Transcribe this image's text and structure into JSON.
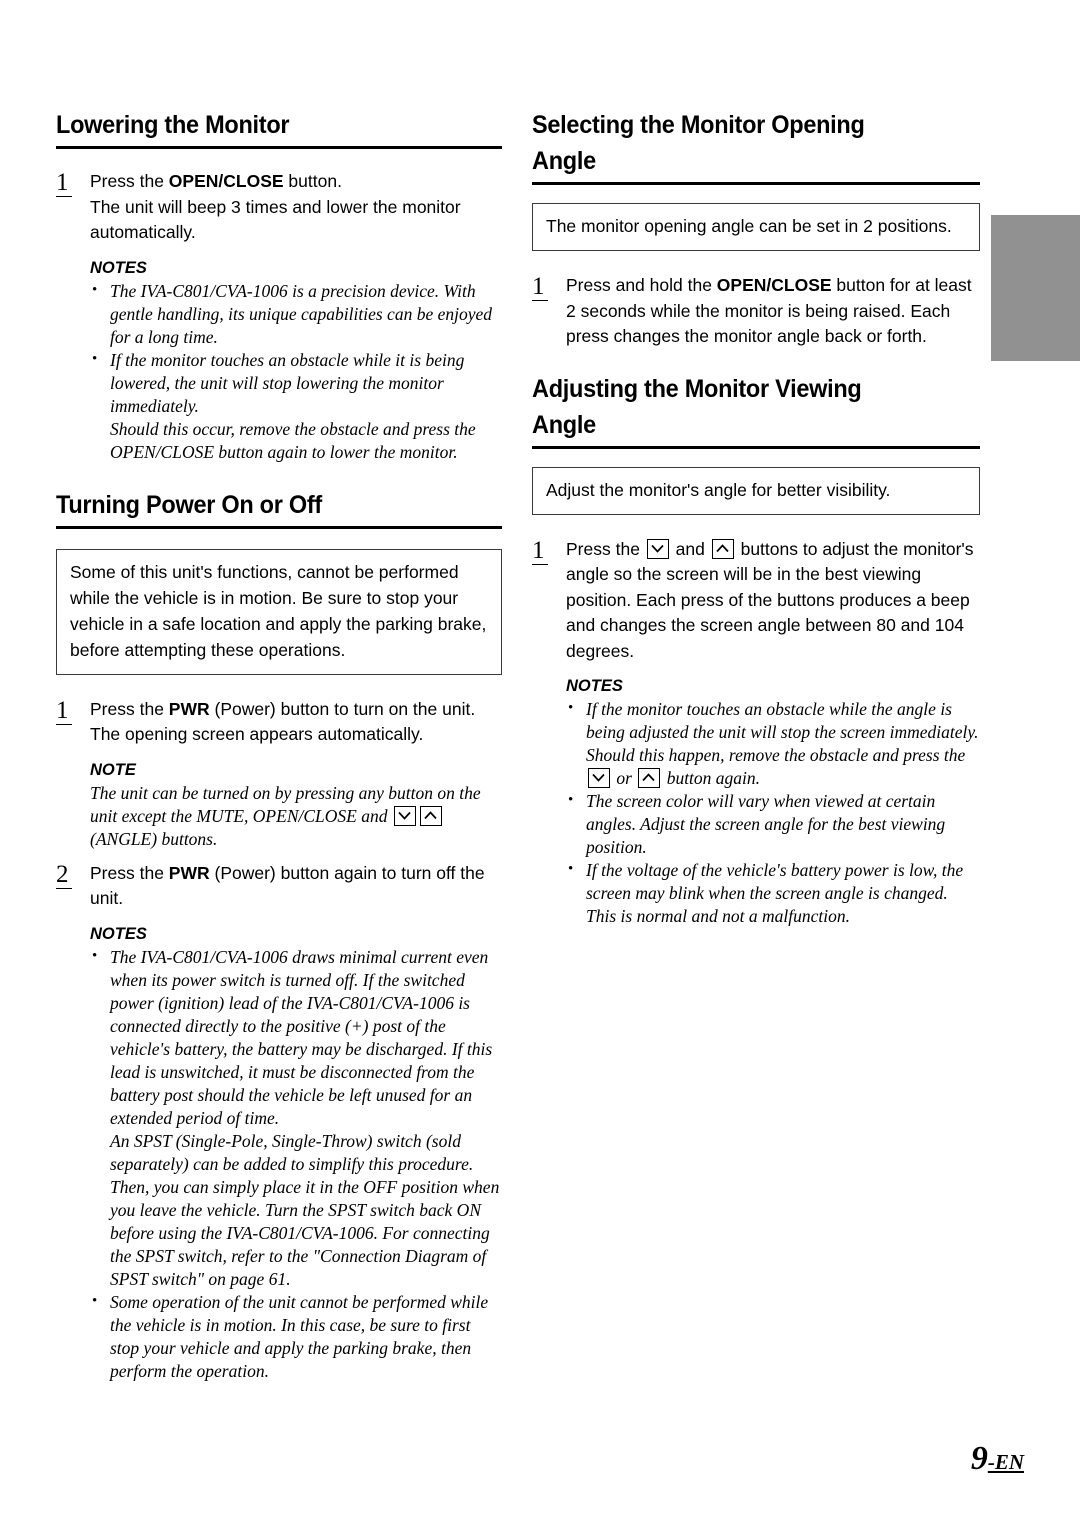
{
  "page": {
    "folio_number": "9",
    "folio_suffix": "-EN",
    "edge_tab_color": "#919191"
  },
  "left_column": {
    "section1": {
      "heading": "Lowering the Monitor",
      "step1": {
        "number": "1",
        "text_before": "Press the ",
        "bold": "OPEN/CLOSE",
        "text_after": " button.",
        "line2": "The unit will beep 3 times and lower the monitor automatically."
      },
      "notes_title": "NOTES",
      "notes": [
        "The IVA-C801/CVA-1006 is a precision device. With gentle handling, its unique capabilities can be enjoyed for a long time.",
        "If the monitor touches an obstacle while it is being lowered, the unit will stop lowering the monitor immediately."
      ],
      "note_continuation": "Should this occur, remove the obstacle and press the OPEN/CLOSE button again to lower the monitor."
    },
    "section2": {
      "heading": "Turning Power On or Off",
      "callout": "Some of this unit's functions, cannot be performed while the vehicle is in motion. Be sure to stop your vehicle in a safe location and apply the parking brake, before attempting these operations.",
      "step1": {
        "number": "1",
        "text_before": "Press the ",
        "bold": "PWR",
        "text_after": " (Power) button to turn on the unit.",
        "line2": "The opening screen appears automatically."
      },
      "note_title": "NOTE",
      "note_part1": "The unit can be turned on by pressing any button on the unit except the MUTE, OPEN/CLOSE and ",
      "note_part2": " (ANGLE) buttons.",
      "step2": {
        "number": "2",
        "text_before": "Press the ",
        "bold": "PWR",
        "text_after": " (Power) button again to turn off the unit."
      },
      "notes_title": "NOTES",
      "notes": [
        "The IVA-C801/CVA-1006 draws minimal current even when its power switch is turned off. If the switched power (ignition) lead of the IVA-C801/CVA-1006 is connected directly to the positive (+) post of the vehicle's battery, the battery may be discharged. If this lead is unswitched, it must be disconnected from the battery post should the vehicle be left unused for an extended period of time.",
        "Some operation of the unit cannot be performed while the vehicle is in motion. In this case, be sure to first stop your vehicle and apply the parking brake, then perform the operation."
      ],
      "note1_continuation": "An SPST (Single-Pole, Single-Throw) switch (sold separately) can be added to simplify this procedure. Then, you can simply place it in the OFF position when you leave the vehicle. Turn the SPST switch back ON before using the IVA-C801/CVA-1006. For connecting the SPST switch, refer to the \"Connection Diagram of SPST switch\" on page 61."
    }
  },
  "right_column": {
    "section3": {
      "heading_line1": "Selecting the Monitor Opening",
      "heading_line2": "Angle",
      "callout": "The monitor opening angle can be set in 2 positions.",
      "step1": {
        "number": "1",
        "text_before": "Press and hold the ",
        "bold": "OPEN/CLOSE",
        "text_after": " button for at least 2 seconds while the monitor is being raised. Each press changes the monitor angle back or forth."
      }
    },
    "section4": {
      "heading_line1": "Adjusting the Monitor Viewing",
      "heading_line2": "Angle",
      "callout": "Adjust the monitor's angle for better visibility.",
      "step1": {
        "number": "1",
        "text_before": "Press the ",
        "text_middle": " and ",
        "text_after": " buttons to adjust the monitor's angle so the screen will be in the best viewing position. Each press of the buttons produces a beep and changes the screen angle between 80 and 104 degrees."
      },
      "notes_title": "NOTES",
      "note1_part1": "If the monitor touches an obstacle while the angle is being adjusted the unit will stop the screen immediately. Should this happen, remove the obstacle and press the ",
      "note1_part2": " or ",
      "note1_part3": " button again.",
      "notes_rest": [
        "The screen color will vary when viewed at certain angles. Adjust the screen angle for the best viewing position.",
        "If the voltage of the vehicle's battery power is low, the screen may blink when the screen angle is changed. This is normal and not a malfunction."
      ]
    }
  },
  "icons": {
    "angle_down": "chevron-down-button-icon",
    "angle_up": "chevron-up-button-icon"
  }
}
